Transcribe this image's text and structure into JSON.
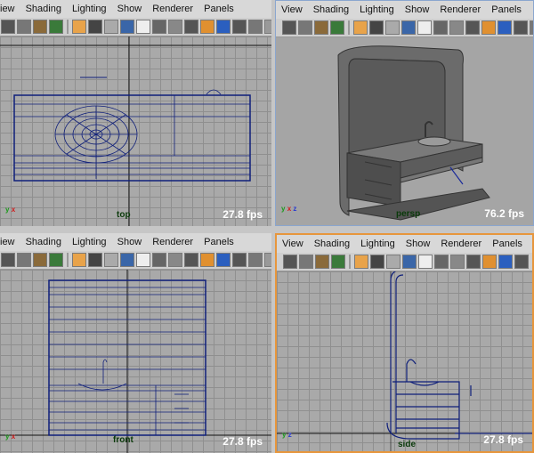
{
  "menu": {
    "view": "View",
    "view_cut": "iew",
    "shading": "Shading",
    "lighting": "Lighting",
    "show": "Show",
    "renderer": "Renderer",
    "panels": "Panels"
  },
  "viewports": {
    "top": {
      "camera": "top",
      "fps": "27.8 fps"
    },
    "persp": {
      "camera": "persp",
      "fps": "76.2 fps"
    },
    "front": {
      "camera": "front",
      "fps": "27.8 fps"
    },
    "side": {
      "camera": "side",
      "fps": "27.8 fps"
    }
  },
  "axis_labels": {
    "x": "x",
    "y": "y",
    "z": "z"
  },
  "colors": {
    "wireframe": "#0f1f7a",
    "active_border": "#e7963c",
    "grid": "#a9a9a9"
  }
}
